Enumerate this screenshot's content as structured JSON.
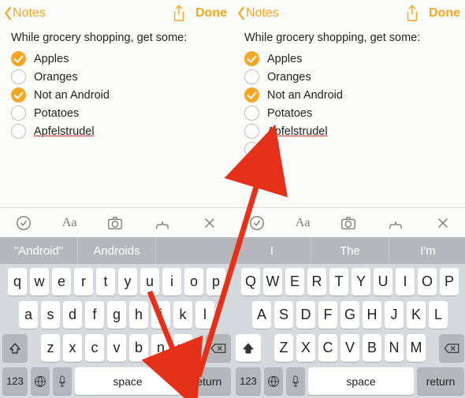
{
  "nav": {
    "back_label": "Notes",
    "done_label": "Done"
  },
  "note": {
    "intro": "While grocery shopping, get some:",
    "items": [
      {
        "label": "Apples",
        "checked": true
      },
      {
        "label": "Oranges",
        "checked": false
      },
      {
        "label": "Not an Android",
        "checked": true
      },
      {
        "label": "Potatoes",
        "checked": false
      },
      {
        "label": "Apfelstrudel",
        "checked": false,
        "misspelled": true
      }
    ]
  },
  "toolbar": {
    "font_label": "Aa"
  },
  "suggestions_left": [
    "\"Android\"",
    "Androids",
    ""
  ],
  "suggestions_right": [
    "I",
    "The",
    "I'm"
  ],
  "keyboard": {
    "row1_lower": [
      "q",
      "w",
      "e",
      "r",
      "t",
      "y",
      "u",
      "i",
      "o",
      "p"
    ],
    "row1_upper": [
      "Q",
      "W",
      "E",
      "R",
      "T",
      "Y",
      "U",
      "I",
      "O",
      "P"
    ],
    "row2_lower": [
      "a",
      "s",
      "d",
      "f",
      "g",
      "h",
      "j",
      "k",
      "l"
    ],
    "row2_upper": [
      "A",
      "S",
      "D",
      "F",
      "G",
      "H",
      "J",
      "K",
      "L"
    ],
    "row3_lower": [
      "z",
      "x",
      "c",
      "v",
      "b",
      "n",
      "m"
    ],
    "row3_upper": [
      "Z",
      "X",
      "C",
      "V",
      "B",
      "N",
      "M"
    ],
    "numkey": "123",
    "space": "space",
    "return": "return"
  }
}
